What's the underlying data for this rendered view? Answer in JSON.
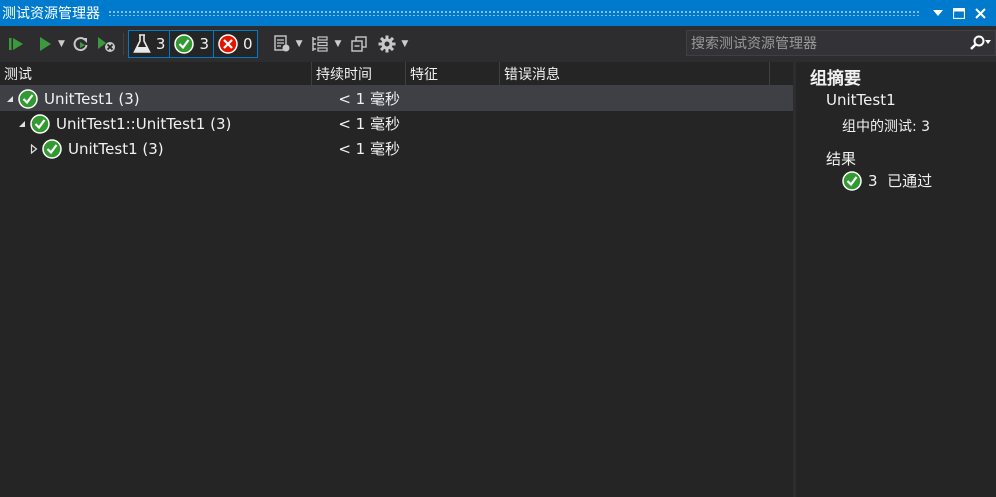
{
  "window": {
    "title": "测试资源管理器",
    "controls": [
      "dropdown-icon",
      "maximize-icon",
      "close-icon"
    ]
  },
  "toolbar": {
    "run_all_icon": "run-all-icon",
    "run_icon": "run-icon",
    "refresh_icon": "refresh-icon",
    "cancel_icon": "cancel-icon",
    "filters": [
      {
        "icon": "flask-icon",
        "count": "3"
      },
      {
        "icon": "passed-icon",
        "count": "3"
      },
      {
        "icon": "failed-icon",
        "count": "0"
      }
    ],
    "playlist_icon": "playlist-icon",
    "group_icon": "group-by-icon",
    "collapse_icon": "collapse-icon",
    "settings_icon": "gear-icon"
  },
  "search": {
    "placeholder": "搜索测试资源管理器"
  },
  "grid": {
    "columns": [
      "测试",
      "持续时间",
      "特征",
      "错误消息"
    ],
    "rows": [
      {
        "name": "UnitTest1 (3)",
        "duration": "< 1 毫秒",
        "expanded": true,
        "level": 0,
        "selected": true
      },
      {
        "name": "UnitTest1::UnitTest1 (3)",
        "duration": "< 1 毫秒",
        "expanded": true,
        "level": 1,
        "selected": false
      },
      {
        "name": "UnitTest1 (3)",
        "duration": "< 1 毫秒",
        "expanded": false,
        "level": 2,
        "selected": false
      }
    ]
  },
  "summary": {
    "heading": "组摘要",
    "group_name": "UnitTest1",
    "group_count": "组中的测试: 3",
    "result_label": "结果",
    "passed_text": "3  已通过"
  },
  "colors": {
    "accent": "#007acc",
    "pass": "#339933",
    "fail": "#e51400",
    "background": "#252526"
  }
}
